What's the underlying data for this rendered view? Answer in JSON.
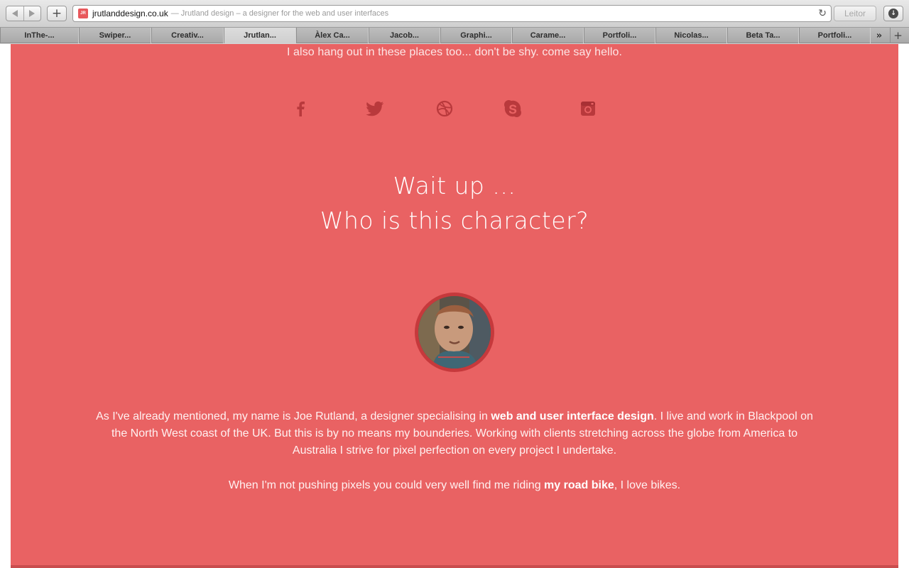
{
  "browser": {
    "url_domain": "jrutlanddesign.co.uk",
    "url_title": "— Jrutland design – a designer for the web and user interfaces",
    "favicon_letter": "JR",
    "new_tab_glyph": "+",
    "reader_label": "Leitor",
    "tab_overflow_glyph": "»",
    "tab_add_glyph": "+",
    "tabs": [
      {
        "label": "InThe-..."
      },
      {
        "label": "Swiper..."
      },
      {
        "label": "Creativ..."
      },
      {
        "label": "Jrutlan..."
      },
      {
        "label": "Àlex Ca..."
      },
      {
        "label": "Jacob..."
      },
      {
        "label": "Graphi..."
      },
      {
        "label": "Carame..."
      },
      {
        "label": "Portfoli..."
      },
      {
        "label": "Nicolas..."
      },
      {
        "label": "Beta Ta..."
      },
      {
        "label": "Portfoli..."
      }
    ]
  },
  "page": {
    "accent_color": "#e96263",
    "hangout_text": "I also hang out in these places too... don't be shy. come say hello.",
    "social_icons": [
      "facebook-icon",
      "twitter-icon",
      "dribbble-icon",
      "skype-icon",
      "instagram-icon"
    ],
    "heading_line1": "Wait up ...",
    "heading_line2": "Who is this character?",
    "bio_part1": "As I've already mentioned, my name is Joe Rutland, a designer specialising in ",
    "bio_link": "web and user interface design",
    "bio_part2": ". I live and work in Blackpool on the North West coast of the UK. But this is by no means my bounderies. Working with clients stretching across the globe from America to Australia I strive for pixel perfection on every project I undertake.",
    "bike_part1": "When I'm not pushing pixels you could very well find me riding ",
    "bike_link": "my road bike",
    "bike_part2": ", I love bikes."
  }
}
